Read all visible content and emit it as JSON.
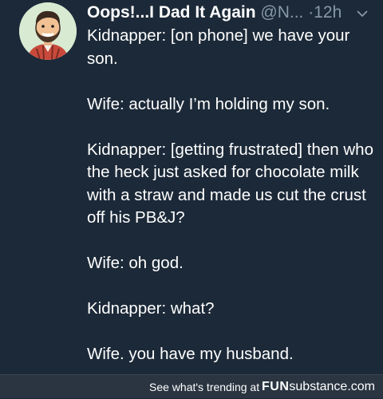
{
  "tweet": {
    "display_name": "Oops!...I Dad It Again",
    "handle": "@N...",
    "separator": "·",
    "time": "12h",
    "lines": [
      "Kidnapper: [on phone] we have your son.",
      "Wife: actually I’m holding my son.",
      "Kidnapper: [getting frustrated] then who the heck just asked for chocolate milk with a straw and made us cut the crust off his PB&J?",
      "Wife: oh god.",
      "Kidnapper: what?",
      "Wife. you have my husband."
    ]
  },
  "footer": {
    "text": "See what's trending at",
    "brand_bold": "FUN",
    "brand_rest": "substance.com"
  },
  "colors": {
    "background": "#1c2938",
    "secondary_text": "#8899a6",
    "avatar_bg": "#d8ead2",
    "footer_bg": "#2a3541"
  },
  "icons": {
    "avatar": "cartoon-dad-avatar",
    "menu": "chevron-down-icon"
  }
}
